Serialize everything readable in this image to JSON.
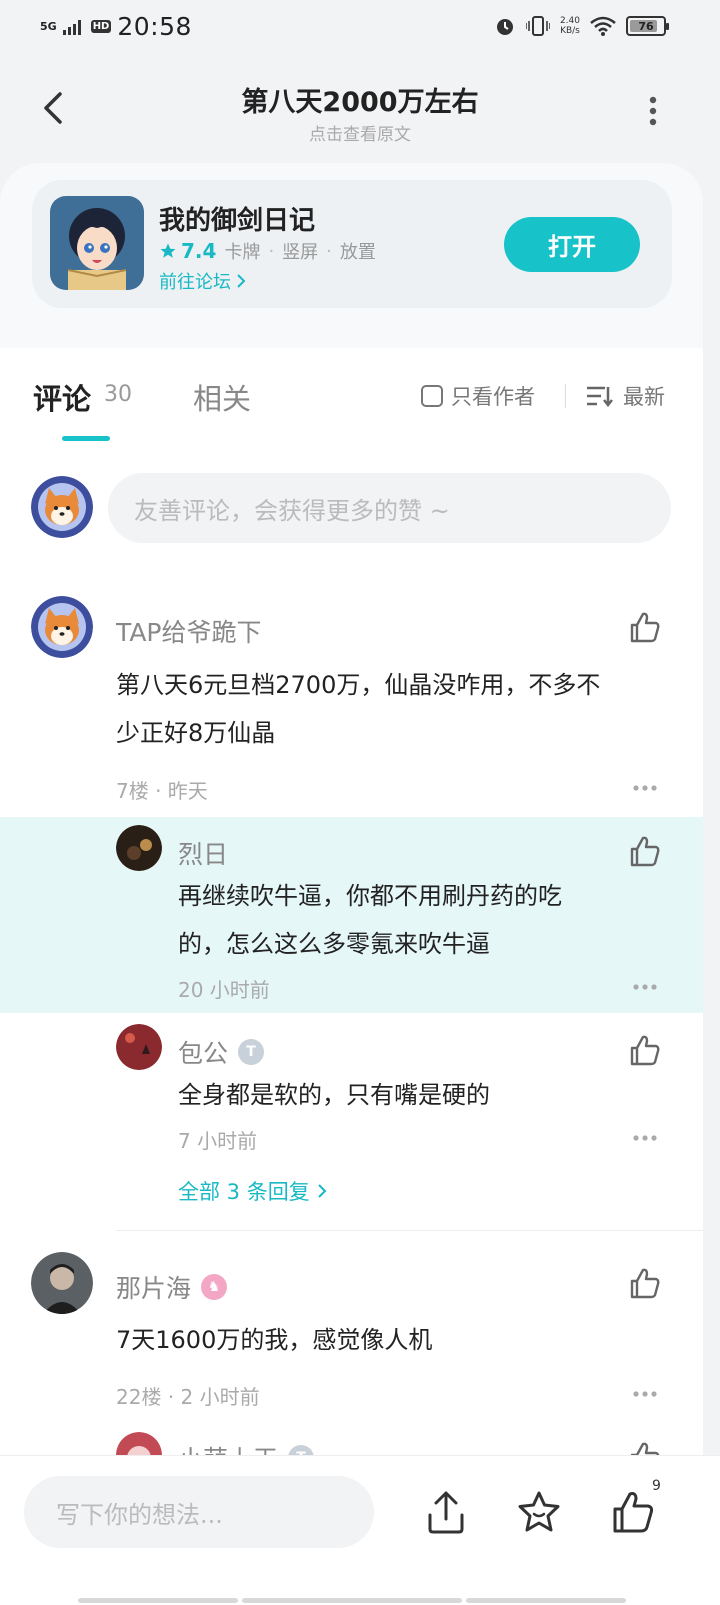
{
  "status_bar": {
    "time": "20:58",
    "network": "5G",
    "hd": "HD",
    "net_speed_value": "2.40",
    "net_speed_unit": "KB/s",
    "battery": "76"
  },
  "header": {
    "title": "第八天2000万左右",
    "subtitle": "点击查看原文"
  },
  "app_card": {
    "name": "我的御剑日记",
    "rating": "7.4",
    "tags": [
      "卡牌",
      "竖屏",
      "放置"
    ],
    "forum_link": "前往论坛",
    "open_button": "打开"
  },
  "tabs": {
    "comment_label": "评论",
    "comment_count": "30",
    "related_label": "相关",
    "author_only": "只看作者",
    "sort": "最新"
  },
  "comment_input": {
    "placeholder": "友善评论，会获得更多的赞 ~"
  },
  "comments": [
    {
      "user": "TAP给爷跪下",
      "text_line1": "第八天6元旦档2700万，仙晶没咋用，不多不",
      "text_line2": "少正好8万仙晶",
      "meta": "7楼 · 昨天",
      "replies": [
        {
          "user": "烈日",
          "text_line1": "再继续吹牛逼，你都不用刷丹药的吃",
          "text_line2": "的，怎么这么多零氪来吹牛逼",
          "time": "20 小时前"
        },
        {
          "user": "包公",
          "badge": "T",
          "text_line1": "全身都是软的，只有嘴是硬的",
          "time": "7 小时前"
        }
      ],
      "view_all_replies": "全部 3 条回复"
    },
    {
      "user": "那片海",
      "badge": "♞",
      "text_line1": "7天1600万的我，感觉像人机",
      "meta": "22楼 · 2 小时前",
      "partial_reply_user": "小萌上天",
      "partial_reply_badge": "T"
    }
  ],
  "bottom_bar": {
    "input_placeholder": "写下你的想法...",
    "like_count": "9"
  },
  "colors": {
    "accent": "#18c2c9",
    "highlight": "#e6f7f8"
  }
}
